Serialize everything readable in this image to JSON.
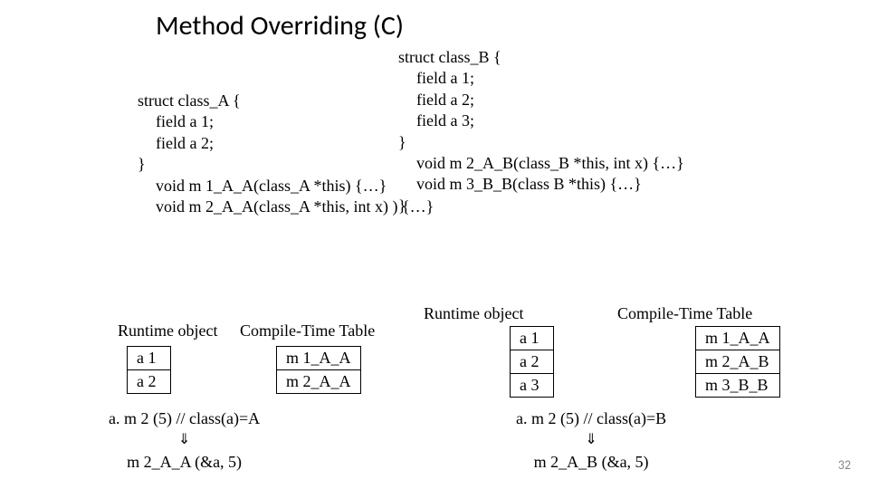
{
  "chart_data": {
    "type": "table",
    "class_A": {
      "runtime_object": [
        "a 1",
        "a 2"
      ],
      "compile_time_table": [
        "m 1_A_A",
        "m 2_A_A"
      ]
    },
    "class_B": {
      "runtime_object": [
        "a 1",
        "a 2",
        "a 3"
      ],
      "compile_time_table": [
        "m 1_A_A",
        "m 2_A_B",
        "m 3_B_B"
      ]
    }
  },
  "title": "Method Overriding (C)",
  "page": "32",
  "structA": {
    "decl": "struct class_A {",
    "f1": "field a 1;",
    "f2": "field a 2;",
    "close": "}",
    "m1": "void m 1_A_A(class_A *this) {…}",
    "m2": "void m 2_A_A(class_A *this, int x) ) {…}"
  },
  "structB": {
    "decl": "struct class_B  {",
    "f1": "field a 1;",
    "f2": "field a 2;",
    "f3": "field a 3;",
    "close": "}",
    "m2": "void m 2_A_B(class_B *this, int x) {…}",
    "m3": "void m 3_B_B(class B *this) {…}",
    "close2": "}"
  },
  "labels": {
    "runtime_object": "Runtime object",
    "compile_time_table": "Compile-Time Table"
  },
  "tableA": {
    "rt": [
      "a 1",
      "a 2"
    ],
    "ct": [
      "m 1_A_A",
      "m 2_A_A"
    ]
  },
  "tableB": {
    "rt": [
      "a 1",
      "a 2",
      "a 3"
    ],
    "ct": [
      "m 1_A_A",
      "m 2_A_B",
      "m 3_B_B"
    ]
  },
  "derivA": {
    "l1": "a. m 2 (5) // class(a)=A",
    "arr": "⇓",
    "l2": "m 2_A_A (&a, 5)"
  },
  "derivB": {
    "l1": "a. m 2 (5) // class(a)=B",
    "arr": "⇓",
    "l2": "m 2_A_B (&a, 5)"
  }
}
